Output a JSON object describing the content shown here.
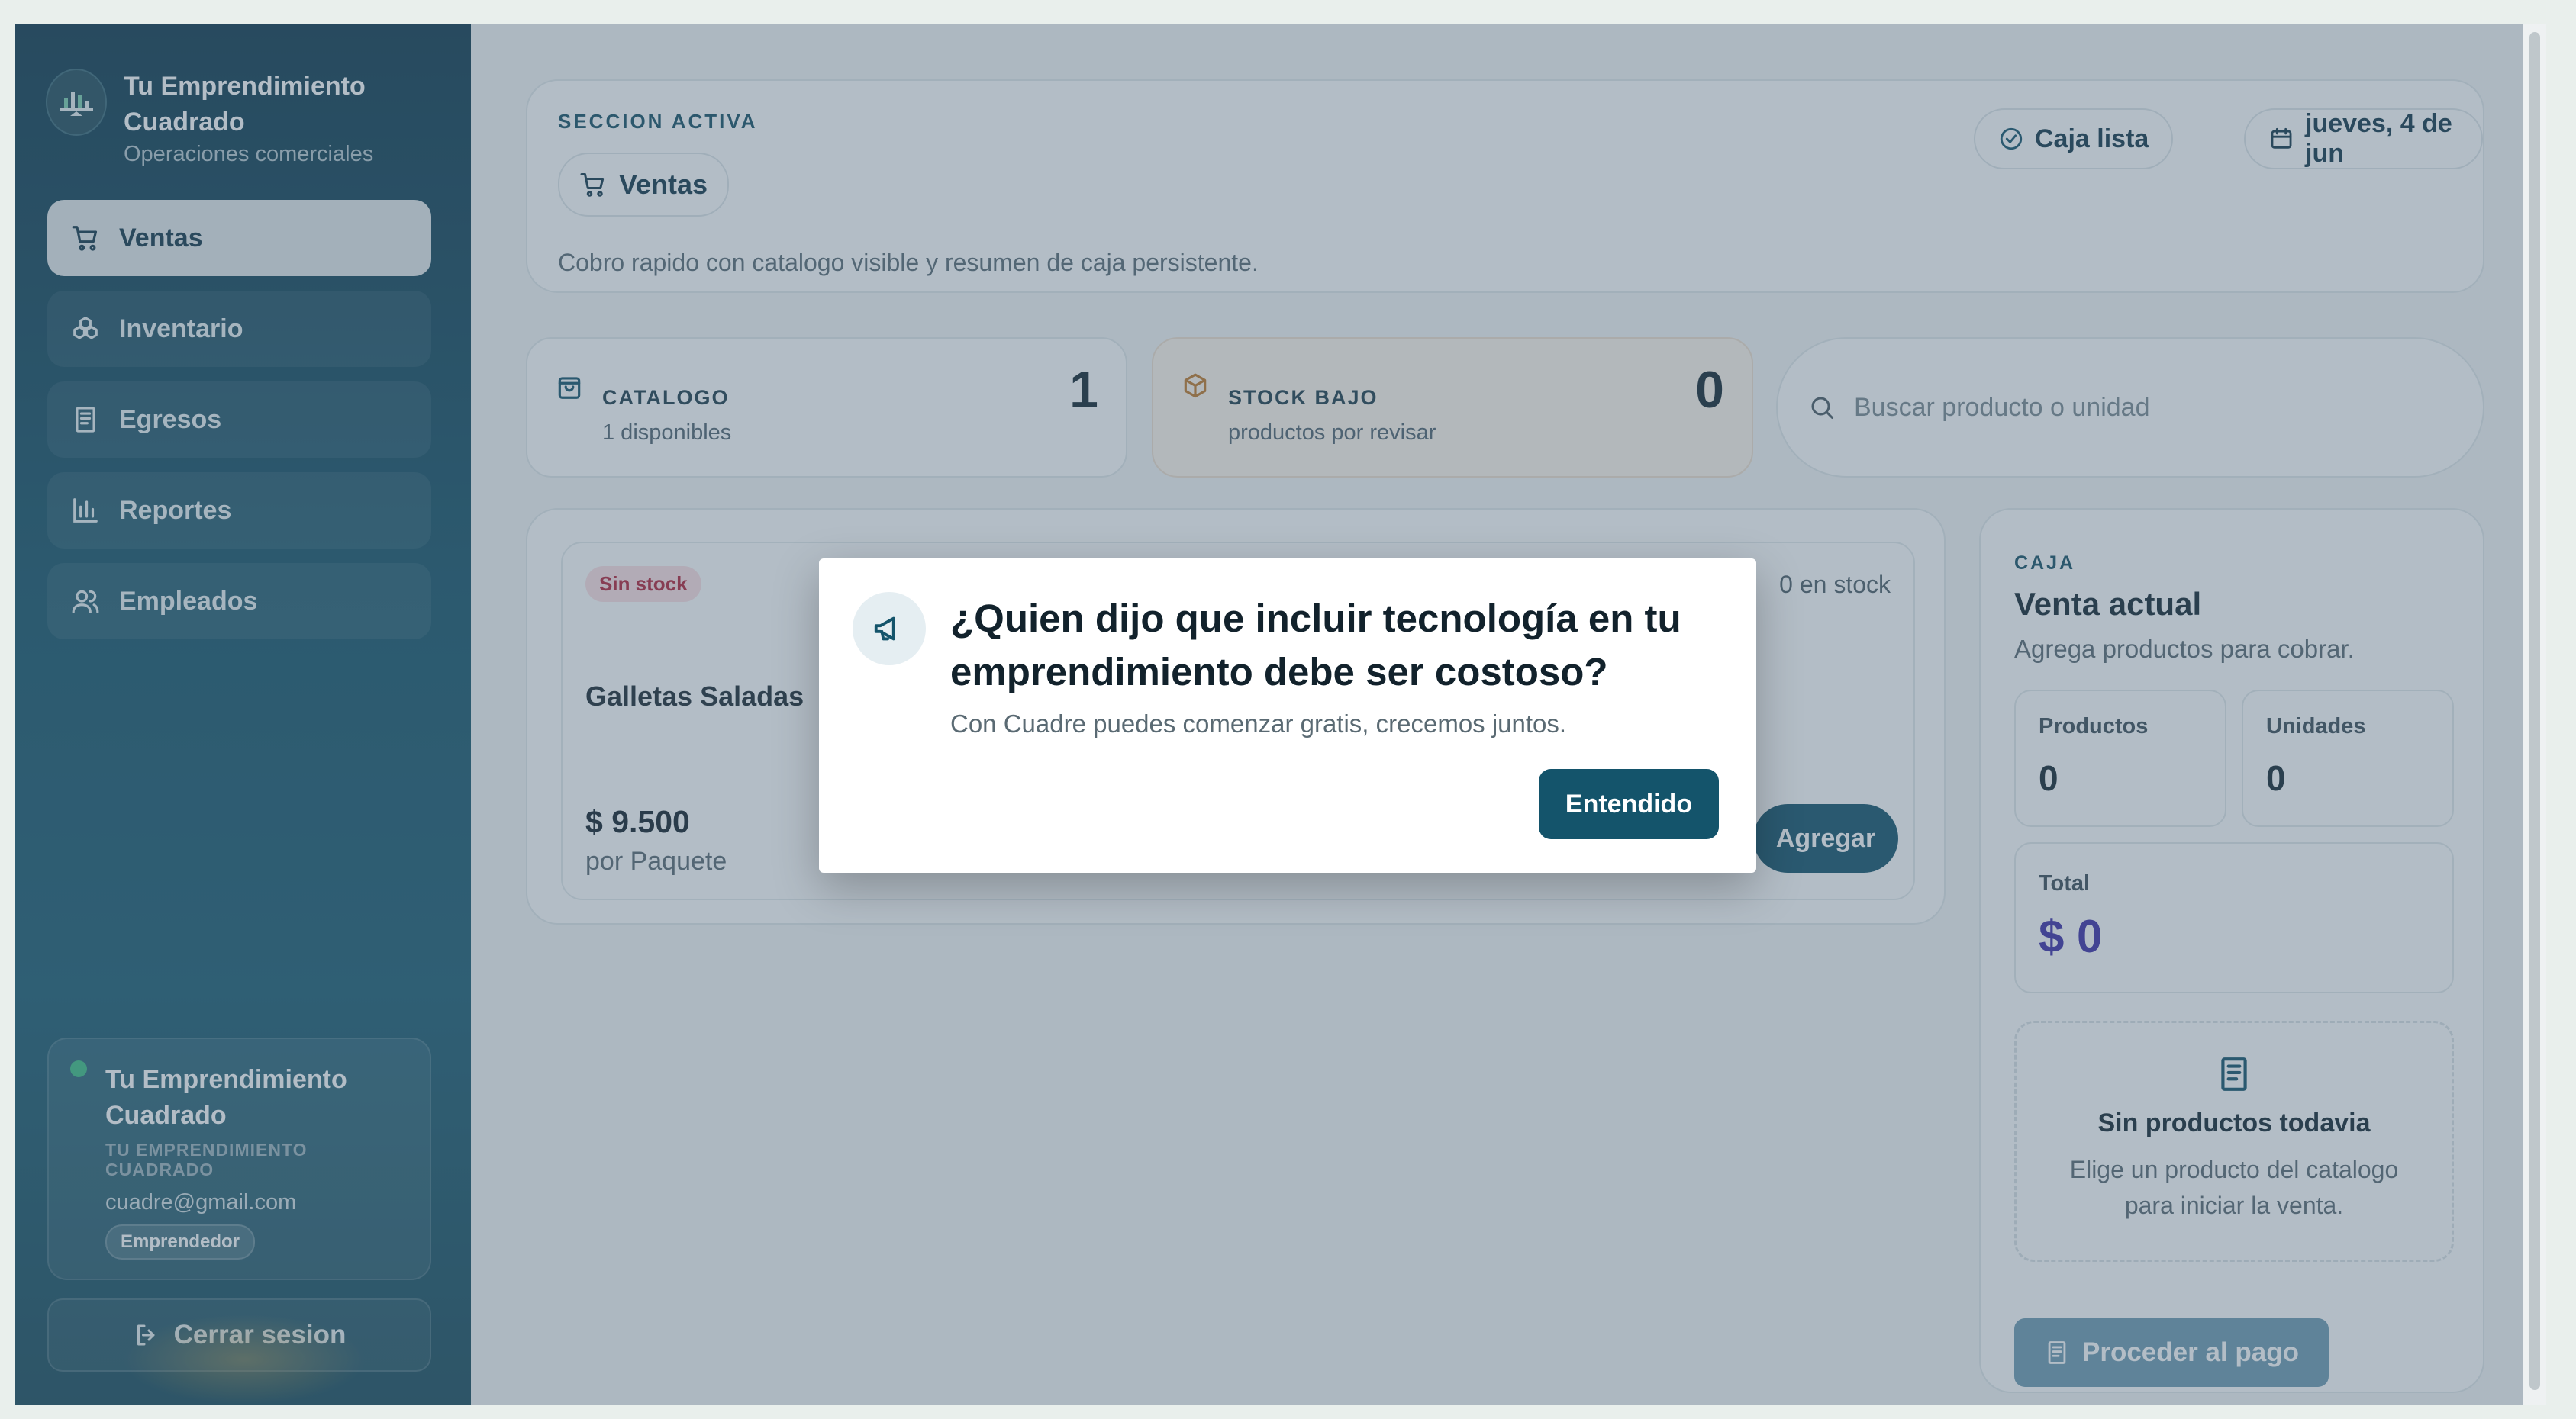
{
  "brand": {
    "name": "Tu Emprendimiento Cuadrado",
    "subtitle": "Operaciones comerciales"
  },
  "nav": [
    {
      "label": "Ventas",
      "icon": "cart-icon",
      "active": true
    },
    {
      "label": "Inventario",
      "icon": "boxes-icon",
      "active": false
    },
    {
      "label": "Egresos",
      "icon": "receipt-icon",
      "active": false
    },
    {
      "label": "Reportes",
      "icon": "bar-chart-icon",
      "active": false
    },
    {
      "label": "Empleados",
      "icon": "users-icon",
      "active": false
    }
  ],
  "profile": {
    "name": "Tu Emprendimiento Cuadrado",
    "company": "TU EMPRENDIMIENTO CUADRADO",
    "email": "cuadre@gmail.com",
    "role": "Emprendedor"
  },
  "logout_label": "Cerrar sesion",
  "section": {
    "eyebrow": "SECCION ACTIVA",
    "title": "Ventas",
    "description": "Cobro rapido con catalogo visible y resumen de caja persistente.",
    "status": "Caja lista",
    "date": "jueves, 4 de jun"
  },
  "stats": {
    "catalog": {
      "label": "CATALOGO",
      "sub": "1 disponibles",
      "value": "1"
    },
    "low_stock": {
      "label": "STOCK BAJO",
      "sub": "productos por revisar",
      "value": "0"
    }
  },
  "search": {
    "placeholder": "Buscar producto o unidad"
  },
  "product": {
    "badge": "Sin stock",
    "stock": "0 en stock",
    "name": "Galletas Saladas",
    "name_suffix": "S",
    "price": "$ 9.500",
    "unit": "por Paquete",
    "add_label": "Agregar"
  },
  "cart": {
    "eyebrow": "CAJA",
    "title": "Venta actual",
    "subtitle": "Agrega productos para cobrar.",
    "products_label": "Productos",
    "products_value": "0",
    "units_label": "Unidades",
    "units_value": "0",
    "total_label": "Total",
    "total_value": "$ 0",
    "empty_title": "Sin productos todavia",
    "empty_text": "Elige un producto del catalogo para iniciar la venta.",
    "checkout_label": "Proceder al pago"
  },
  "modal": {
    "title": "¿Quien dijo que incluir tecnología en tu emprendimiento debe ser costoso?",
    "subtitle": "Con Cuadre puedes comenzar gratis, crecemos juntos.",
    "button": "Entendido",
    "icon": "megaphone-icon"
  },
  "colors": {
    "primary": "#14546b",
    "sidebar": "#175469",
    "danger": "#b3243a",
    "total": "#3d2fa8"
  }
}
